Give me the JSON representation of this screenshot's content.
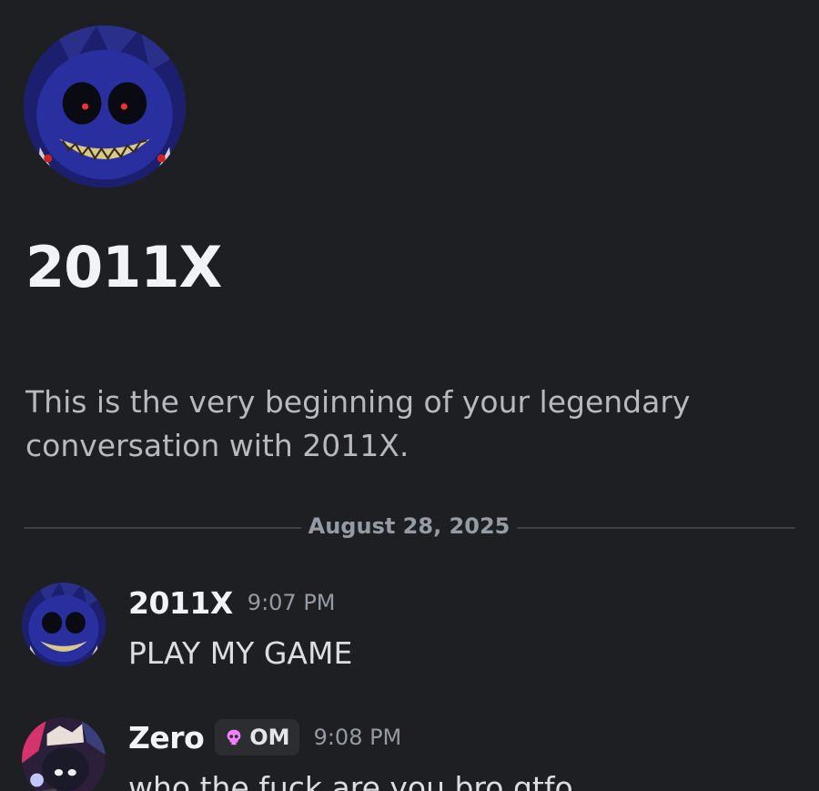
{
  "channel": {
    "name": "2011X",
    "intro_text": "This is the very beginning of your legendary conversation with 2011X."
  },
  "divider": {
    "date": "August 28, 2025"
  },
  "messages": [
    {
      "author": "2011X",
      "time": "9:07 PM",
      "text": "PLAY MY GAME",
      "avatar_icon": "sonic-exe-avatar"
    },
    {
      "author": "Zero",
      "tag": "OM",
      "tag_icon": "skull-icon",
      "time": "9:08 PM",
      "text": "who the fuck are you bro gtfo",
      "avatar_icon": "anime-avatar"
    }
  ],
  "colors": {
    "background": "#1e1f22",
    "primary_text": "#f2f3f5",
    "secondary_text": "#b5bac1",
    "muted_text": "#949ba4",
    "tag_background": "#2b2d31",
    "skull_pink": "#f47fff"
  }
}
